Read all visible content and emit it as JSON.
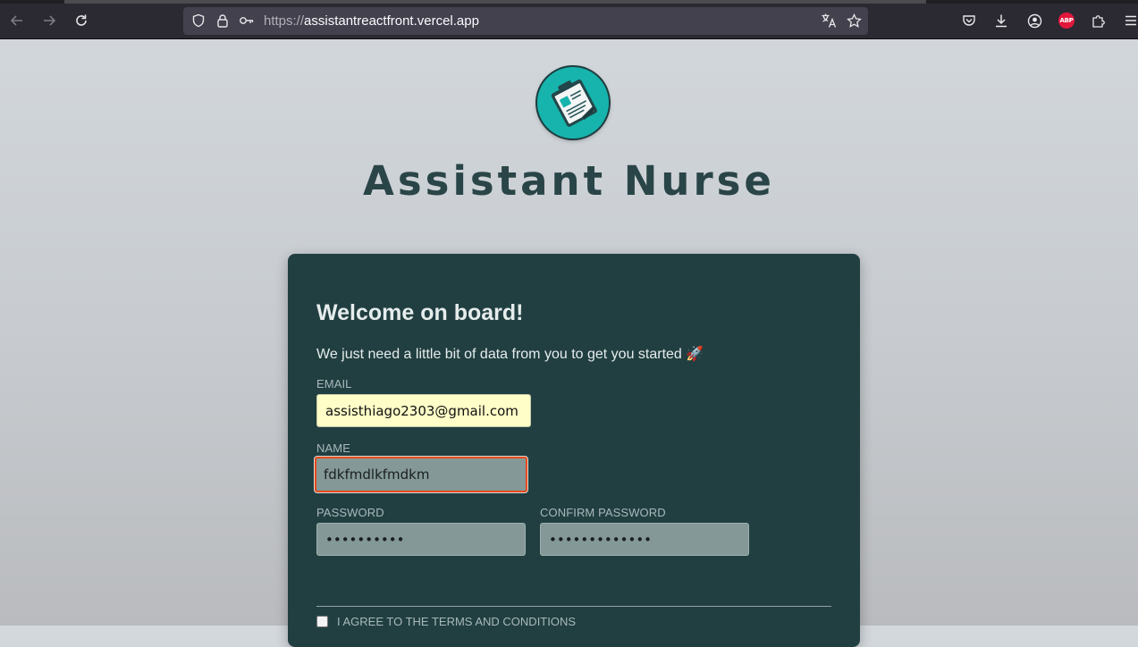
{
  "browser": {
    "url_scheme": "https://",
    "url_host": "assistantreactfront.vercel.app",
    "icons": {
      "back": "back-arrow-icon",
      "forward": "forward-arrow-icon",
      "reload": "reload-icon",
      "tracking": "shield-icon",
      "lock": "lock-icon",
      "permissions": "key-icon",
      "translate": "translate-icon",
      "bookmark": "star-icon",
      "pocket": "pocket-icon",
      "downloads": "download-icon",
      "account": "account-icon",
      "adblock": "abp-icon",
      "extensions": "puzzle-icon",
      "menu": "hamburger-menu-icon"
    },
    "adblock_badge": "ABP"
  },
  "app": {
    "title": "Assistant Nurse",
    "logo_icon": "clipboard-icon",
    "accent_color": "#16b4ad"
  },
  "form": {
    "heading": "Welcome on board!",
    "subtitle": "We just need a little bit of data from you to get you started",
    "subtitle_emoji": "🚀",
    "email": {
      "label": "EMAIL",
      "value": "assisthiago2303@gmail.com"
    },
    "name": {
      "label": "NAME",
      "value": "fdkfmdlkfmdkm"
    },
    "password": {
      "label": "PASSWORD",
      "value": "••••••••••"
    },
    "confirm_password": {
      "label": "CONFIRM PASSWORD",
      "value": "•••••••••••••"
    },
    "terms_label": "I AGREE TO THE TERMS AND CONDITIONS",
    "terms_checked": false
  },
  "colors": {
    "card_bg": "#213f41",
    "input_bg": "#849897",
    "autofill_bg": "#fffdc8",
    "focus_ring": "#e44b1a",
    "title_color": "#2a4547"
  }
}
